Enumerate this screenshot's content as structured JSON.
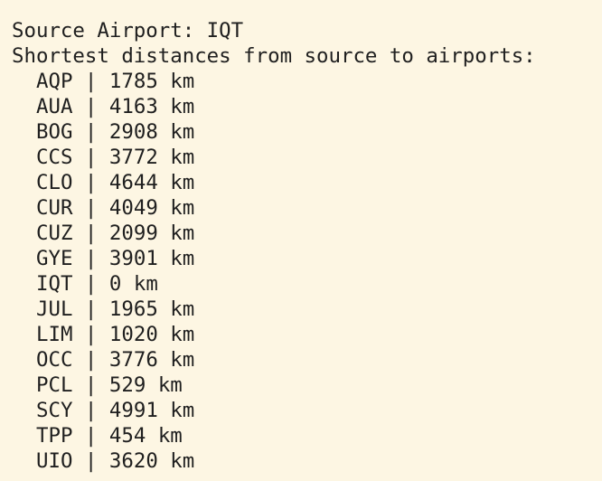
{
  "header": {
    "source_line": "Source Airport: IQT",
    "subtitle_line": "Shortest distances from source to airports:"
  },
  "distances": [
    {
      "code": "AQP",
      "distance": "1785 km"
    },
    {
      "code": "AUA",
      "distance": "4163 km"
    },
    {
      "code": "BOG",
      "distance": "2908 km"
    },
    {
      "code": "CCS",
      "distance": "3772 km"
    },
    {
      "code": "CLO",
      "distance": "4644 km"
    },
    {
      "code": "CUR",
      "distance": "4049 km"
    },
    {
      "code": "CUZ",
      "distance": "2099 km"
    },
    {
      "code": "GYE",
      "distance": "3901 km"
    },
    {
      "code": "IQT",
      "distance": "0 km"
    },
    {
      "code": "JUL",
      "distance": "1965 km"
    },
    {
      "code": "LIM",
      "distance": "1020 km"
    },
    {
      "code": "OCC",
      "distance": "3776 km"
    },
    {
      "code": "PCL",
      "distance": "529 km"
    },
    {
      "code": "SCY",
      "distance": "4991 km"
    },
    {
      "code": "TPP",
      "distance": "454 km"
    },
    {
      "code": "UIO",
      "distance": "3620 km"
    }
  ],
  "separator": " | "
}
